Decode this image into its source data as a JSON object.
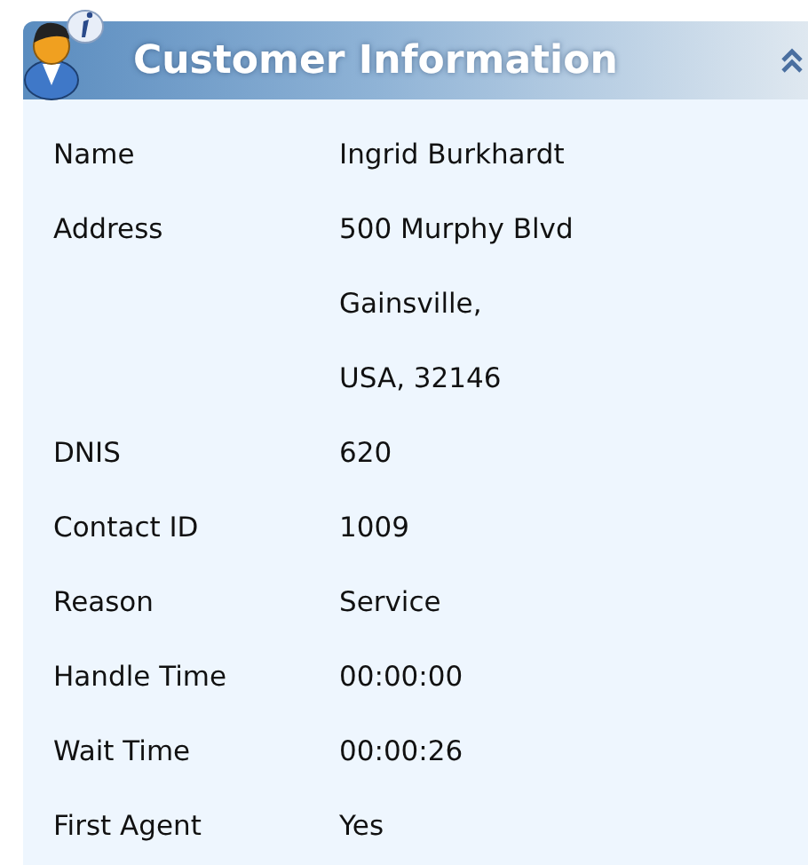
{
  "panel": {
    "title": "Customer Information",
    "expanded": true
  },
  "rows": [
    {
      "label": "Name",
      "lines": [
        "Ingrid Burkhardt"
      ]
    },
    {
      "label": "Address",
      "lines": [
        "500 Murphy Blvd",
        "Gainsville,",
        "USA, 32146"
      ]
    },
    {
      "label": "DNIS",
      "lines": [
        "620"
      ]
    },
    {
      "label": "Contact ID",
      "lines": [
        "1009"
      ]
    },
    {
      "label": "Reason",
      "lines": [
        "Service"
      ]
    },
    {
      "label": "Handle Time",
      "lines": [
        "00:00:00"
      ]
    },
    {
      "label": "Wait Time",
      "lines": [
        "00:00:26"
      ]
    },
    {
      "label": "First Agent",
      "lines": [
        "Yes"
      ]
    }
  ]
}
